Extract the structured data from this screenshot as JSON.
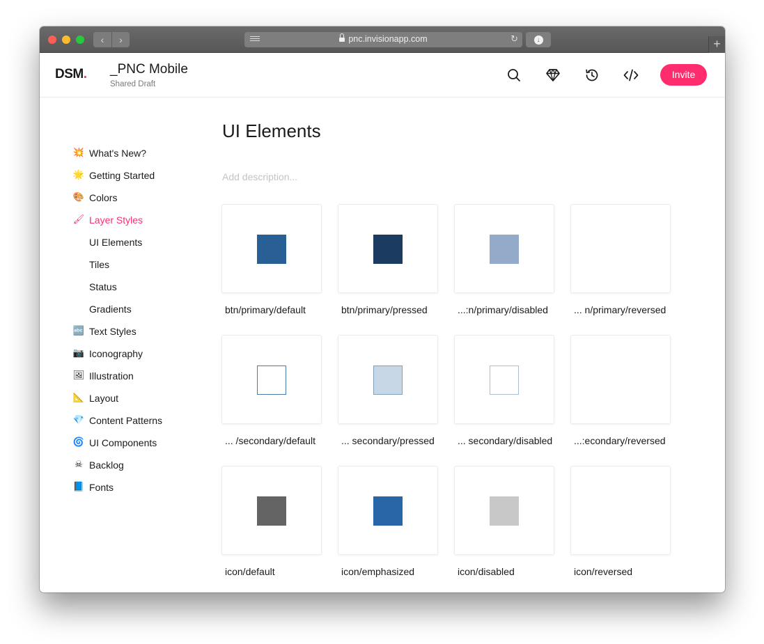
{
  "browser": {
    "url": "pnc.invisionapp.com",
    "nav_back": "‹",
    "nav_forward": "›",
    "new_tab": "+"
  },
  "header": {
    "logo_text": "DSM",
    "logo_dot": ".",
    "project_title": "_PNC Mobile",
    "project_subtitle": "Shared Draft",
    "invite_label": "Invite",
    "icons": [
      "search-icon",
      "sketch-diamond-icon",
      "history-icon",
      "code-icon"
    ]
  },
  "colors": {
    "accent": "#ff2d6d"
  },
  "sidebar": {
    "items": [
      {
        "emoji": "💥",
        "label": "What's New?"
      },
      {
        "emoji": "🌟",
        "label": "Getting Started"
      },
      {
        "emoji": "🎨",
        "label": "Colors"
      },
      {
        "emoji": "🖌",
        "label": "Layer Styles",
        "active": true
      },
      {
        "label": "UI Elements",
        "sub": true
      },
      {
        "label": "Tiles",
        "sub": true
      },
      {
        "label": "Status",
        "sub": true
      },
      {
        "label": "Gradients",
        "sub": true
      },
      {
        "emoji": "🔤",
        "label": "Text Styles"
      },
      {
        "emoji": "📷",
        "label": "Iconography"
      },
      {
        "emoji": "🖼",
        "label": "Illustration"
      },
      {
        "emoji": "📐",
        "label": "Layout"
      },
      {
        "emoji": "💎",
        "label": "Content Patterns"
      },
      {
        "emoji": "🌀",
        "label": "UI Components"
      },
      {
        "emoji": "☠",
        "label": "Backlog"
      },
      {
        "emoji": "📘",
        "label": "Fonts"
      }
    ]
  },
  "main": {
    "title": "UI Elements",
    "description_placeholder": "Add description...",
    "tiles": [
      {
        "label": "btn/primary/default",
        "fill": "#285f94",
        "border": ""
      },
      {
        "label": "btn/primary/pressed",
        "fill": "#1b3b60",
        "border": ""
      },
      {
        "label": "...:n/primary/disabled",
        "fill": "#93abc8",
        "border": ""
      },
      {
        "label": "... n/primary/reversed",
        "fill": "",
        "border": ""
      },
      {
        "label": "... /secondary/default",
        "fill": "#ffffff",
        "border": "#4b7aa8"
      },
      {
        "label": "... secondary/pressed",
        "fill": "#c8d7e5",
        "border": "#7f9fbf"
      },
      {
        "label": "... secondary/disabled",
        "fill": "#ffffff",
        "border": "#a9bed3"
      },
      {
        "label": "...:econdary/reversed",
        "fill": "",
        "border": ""
      },
      {
        "label": "icon/default",
        "fill": "#646464",
        "border": ""
      },
      {
        "label": "icon/emphasized",
        "fill": "#2866a8",
        "border": ""
      },
      {
        "label": "icon/disabled",
        "fill": "#c8c8c8",
        "border": ""
      },
      {
        "label": "icon/reversed",
        "fill": "",
        "border": ""
      }
    ]
  }
}
